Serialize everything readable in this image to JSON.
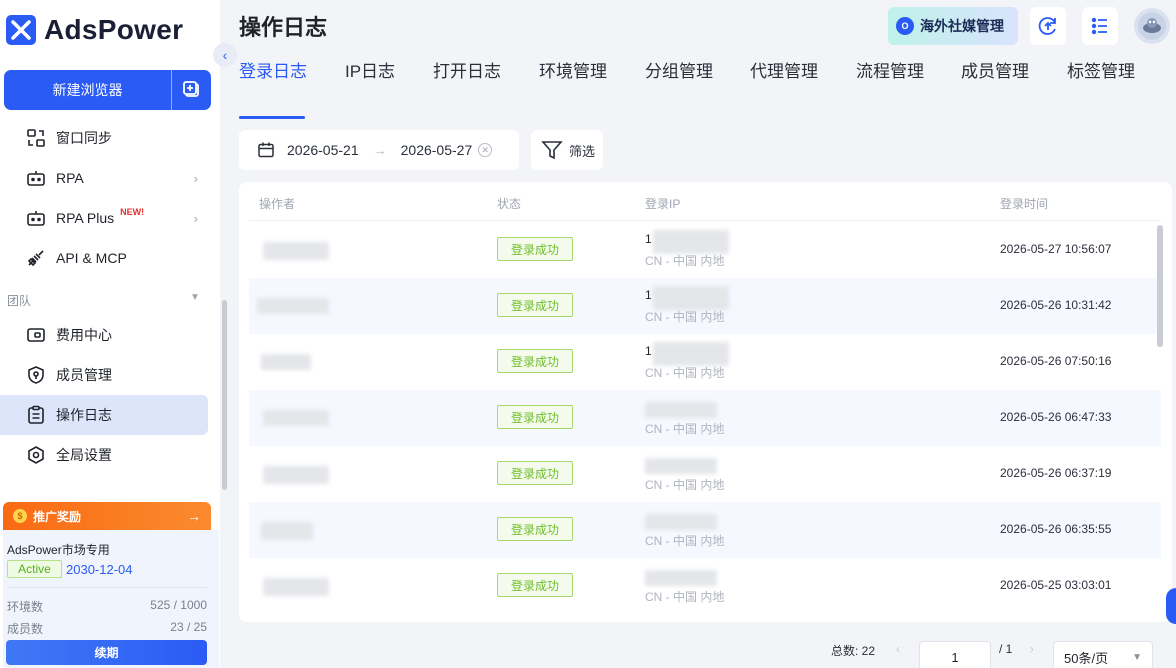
{
  "app": {
    "name": "AdsPower",
    "brand_color": "#2b5bf5"
  },
  "sidebar": {
    "new_browser_label": "新建浏览器",
    "items": [
      {
        "label": "窗口同步",
        "icon": "window-sync-icon",
        "chevron": false
      },
      {
        "label": "RPA",
        "icon": "robot-icon",
        "chevron": true
      },
      {
        "label": "RPA Plus",
        "icon": "robot-plus-icon",
        "chevron": true,
        "badge": "NEW!"
      },
      {
        "label": "API & MCP",
        "icon": "api-plug-icon",
        "chevron": false
      }
    ],
    "team_section_label": "团队",
    "team_items": [
      {
        "label": "费用中心",
        "icon": "wallet-icon"
      },
      {
        "label": "成员管理",
        "icon": "shield-user-icon"
      },
      {
        "label": "操作日志",
        "icon": "clipboard-icon",
        "active": true
      },
      {
        "label": "全局设置",
        "icon": "settings-hex-icon"
      }
    ],
    "promo_label": "推广奖励",
    "plan": {
      "name": "AdsPower市场专用",
      "status": "Active",
      "expiry": "2030-12-04",
      "env_label": "环境数",
      "env_value": "525 / 1000",
      "member_label": "成员数",
      "member_value": "23 / 25",
      "renew_label": "续期"
    }
  },
  "header": {
    "title": "操作日志",
    "banner_label": "海外社媒管理"
  },
  "tabs": [
    {
      "label": "登录日志",
      "active": true
    },
    {
      "label": "IP日志"
    },
    {
      "label": "打开日志"
    },
    {
      "label": "环境管理"
    },
    {
      "label": "分组管理"
    },
    {
      "label": "代理管理"
    },
    {
      "label": "流程管理"
    },
    {
      "label": "成员管理"
    },
    {
      "label": "标签管理"
    }
  ],
  "filters": {
    "start_date": "2026-05-21",
    "end_date": "2026-05-27",
    "filter_label": "筛选"
  },
  "table": {
    "columns": [
      "操作者",
      "状态",
      "登录IP",
      "登录时间"
    ],
    "rows": [
      {
        "status": "登录成功",
        "ip_prefix": "1",
        "location": "CN - 中国 内地",
        "time": "2026-05-27 10:56:07"
      },
      {
        "status": "登录成功",
        "ip_prefix": "1",
        "location": "CN - 中国 内地",
        "time": "2026-05-26 10:31:42"
      },
      {
        "status": "登录成功",
        "ip_prefix": "1",
        "location": "CN - 中国 内地",
        "time": "2026-05-26 07:50:16"
      },
      {
        "status": "登录成功",
        "ip_prefix": "",
        "location": "CN - 中国 内地",
        "time": "2026-05-26 06:47:33"
      },
      {
        "status": "登录成功",
        "ip_prefix": "",
        "location": "CN - 中国 内地",
        "time": "2026-05-26 06:37:19"
      },
      {
        "status": "登录成功",
        "ip_prefix": "",
        "location": "CN - 中国 内地",
        "time": "2026-05-26 06:35:55"
      },
      {
        "status": "登录成功",
        "ip_prefix": "",
        "location": "CN - 中国 内地",
        "time": "2026-05-25 03:03:01"
      }
    ]
  },
  "pagination": {
    "total_label": "总数: 22",
    "current_page": "1",
    "total_pages": "/ 1",
    "page_size": "50条/页"
  }
}
